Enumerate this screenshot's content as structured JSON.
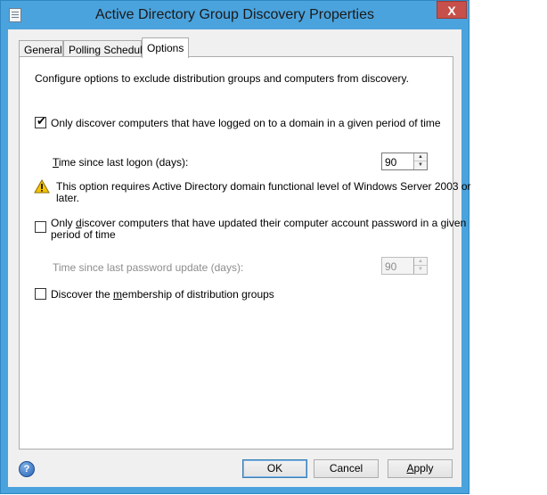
{
  "window": {
    "title": "Active Directory Group Discovery Properties",
    "close_label": "X"
  },
  "tabs": [
    {
      "label": "General",
      "active": false
    },
    {
      "label": "Polling Schedule",
      "active": false
    },
    {
      "label": "Options",
      "active": true
    }
  ],
  "options": {
    "description": "Configure options to exclude distribution groups and computers from discovery.",
    "logon_checkbox": {
      "label": "Only discover computers that have logged on to a domain in a given period of time",
      "checked": true
    },
    "logon_days": {
      "label_rest": "ime since last logon (days):",
      "label_accel": "T",
      "value": "90"
    },
    "warning": {
      "line1": "This option requires Active Directory domain functional level of Windows Server 2003 or",
      "line2": "later.",
      "icon": "warning-icon"
    },
    "password_checkbox": {
      "label_pre": "Only ",
      "label_accel": "d",
      "label_post": "iscover computers that have updated their computer account password in a given",
      "label_line2": "period of time",
      "checked": false
    },
    "password_days": {
      "label": "Time since last password update (days):",
      "value": "90",
      "disabled": true
    },
    "membership_checkbox": {
      "label_pre": "Discover the ",
      "label_accel": "m",
      "label_post": "embership of distribution groups",
      "checked": false
    }
  },
  "buttons": {
    "ok": "OK",
    "cancel": "Cancel",
    "apply_accel": "A",
    "apply_rest": "pply",
    "help_icon": "help-icon"
  },
  "colors": {
    "frame": "#4ba3dd",
    "close": "#c7504a",
    "dialog_bg": "#f0f0f0"
  }
}
